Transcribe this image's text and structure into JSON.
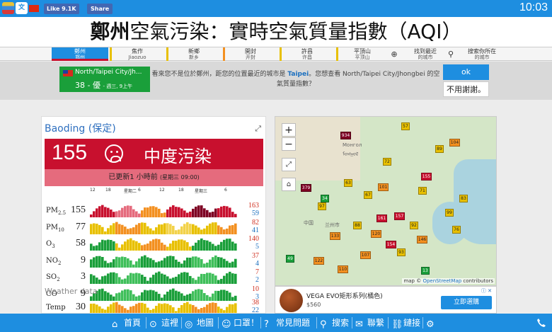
{
  "system_bar": {
    "fb_like_label": "Like 9.1K",
    "share_label": "Share",
    "clock": "10:03"
  },
  "title": {
    "bold": "鄭州",
    "rest": "空氣污染：實時空氣質量指數（AQI）"
  },
  "tabs": [
    {
      "label": "鄭州",
      "sub": "郑州",
      "color": "#c8102e"
    },
    {
      "label": "焦作",
      "sub": "Jiaozuo",
      "color": "#e8c000"
    },
    {
      "label": "新鄉",
      "sub": "新乡",
      "color": "#e8c000"
    },
    {
      "label": "開封",
      "sub": "开封",
      "color": "#f39020"
    },
    {
      "label": "許昌",
      "sub": "许昌",
      "color": "#e8c000"
    },
    {
      "label": "平頂山",
      "sub": "平顶山",
      "color": "#e8c000"
    },
    {
      "label": "找到最近",
      "sub": "的城市",
      "color": ""
    },
    {
      "label": "搜索你所在",
      "sub": "的城市",
      "color": ""
    }
  ],
  "notice": {
    "loc_city": "North/Taipei City/Jh...",
    "loc_aqi": "38 - 優",
    "loc_time": "- 週三, 9上午",
    "msg_prefix": "看來您不是位於鄭州，距您的位置最近的城市是 ",
    "msg_city": "Taipei",
    "msg_suffix": "。您想查看 North/Taipei City/Jhongbei 的空氣質量指數？",
    "ok_label": "ok",
    "no_label": "不用謝謝。"
  },
  "station": {
    "name": "Baoding (保定)",
    "aqi": "155",
    "level": "中度污染",
    "updated": "已更新1 小時前",
    "updated_time": "(星期三 09:00)",
    "axis_labels": [
      "12",
      "18",
      "星期二",
      "6",
      "12",
      "18",
      "星期三",
      "6"
    ],
    "weather_title": "Weather data"
  },
  "pollutants": [
    {
      "name": "PM",
      "sub": "2.5",
      "value": "155",
      "max": "163",
      "min": "59",
      "palette": "red"
    },
    {
      "name": "PM",
      "sub": "10",
      "value": "77",
      "max": "82",
      "min": "41",
      "palette": "yellow"
    },
    {
      "name": "O",
      "sub": "3",
      "value": "58",
      "max": "140",
      "min": "5",
      "palette": "mixed"
    },
    {
      "name": "NO",
      "sub": "2",
      "value": "9",
      "max": "37",
      "min": "4",
      "palette": "green"
    },
    {
      "name": "SO",
      "sub": "2",
      "value": "3",
      "max": "7",
      "min": "2",
      "palette": "green"
    },
    {
      "name": "CO",
      "sub": "",
      "value": "9",
      "max": "10",
      "min": "3",
      "palette": "green"
    },
    {
      "name": "Temp",
      "sub": "",
      "value": "30",
      "max": "38",
      "min": "22",
      "palette": "temp"
    }
  ],
  "map": {
    "zoom_in": "+",
    "zoom_out": "−",
    "attribution_prefix": "map © ",
    "attribution_link": "OpenStreetMap",
    "attribution_suffix": " contributors",
    "places": [
      "Монгол",
      "ᠮᠣᠩᠭᠣᠯ",
      "兰州市",
      "中国"
    ],
    "markers": [
      {
        "v": "57",
        "c": "#e8c000"
      },
      {
        "v": "934",
        "c": "#7e0023"
      },
      {
        "v": "104",
        "c": "#f39020"
      },
      {
        "v": "72",
        "c": "#e8c000"
      },
      {
        "v": "89",
        "c": "#e8c000"
      },
      {
        "v": "155",
        "c": "#c8102e"
      },
      {
        "v": "379",
        "c": "#7e0023"
      },
      {
        "v": "34",
        "c": "#1a9f3a"
      },
      {
        "v": "97",
        "c": "#e8c000"
      },
      {
        "v": "161",
        "c": "#c8102e"
      },
      {
        "v": "157",
        "c": "#c8102e"
      },
      {
        "v": "76",
        "c": "#e8c000"
      },
      {
        "v": "99",
        "c": "#e8c000"
      },
      {
        "v": "133",
        "c": "#f39020"
      },
      {
        "v": "154",
        "c": "#c8102e"
      },
      {
        "v": "122",
        "c": "#f39020"
      },
      {
        "v": "107",
        "c": "#f39020"
      },
      {
        "v": "93",
        "c": "#e8c000"
      },
      {
        "v": "13",
        "c": "#1a9f3a"
      },
      {
        "v": "88",
        "c": "#e8c000"
      },
      {
        "v": "120",
        "c": "#f39020"
      },
      {
        "v": "63",
        "c": "#e8c000"
      },
      {
        "v": "71",
        "c": "#e8c000"
      },
      {
        "v": "92",
        "c": "#e8c000"
      },
      {
        "v": "49",
        "c": "#1a9f3a"
      },
      {
        "v": "110",
        "c": "#f39020"
      },
      {
        "v": "83",
        "c": "#e8c000"
      },
      {
        "v": "146",
        "c": "#f39020"
      },
      {
        "v": "67",
        "c": "#e8c000"
      },
      {
        "v": "101",
        "c": "#f39020"
      }
    ]
  },
  "ad": {
    "title": "VEGA EVO矩形系列(橘色)",
    "price": "$560",
    "button": "立即選購",
    "info": "ⓘ ✕"
  },
  "bottom_nav": [
    {
      "label": "首頁",
      "icon": "home-icon"
    },
    {
      "label": "這裡",
      "icon": "location-icon"
    },
    {
      "label": "地圖",
      "icon": "globe-icon"
    },
    {
      "label": "口罩！",
      "icon": "mask-icon"
    },
    {
      "label": "常見問題",
      "icon": "faq-icon"
    },
    {
      "label": "搜索",
      "icon": "search-icon"
    },
    {
      "label": "聯繫",
      "icon": "contact-icon"
    },
    {
      "label": "鏈接",
      "icon": "link-icon"
    },
    {
      "label": "",
      "icon": "settings-icon"
    }
  ],
  "colors": {
    "accent": "#1e8ee0",
    "unhealthy": "#c8102e",
    "good": "#1a9f3a",
    "moderate": "#e8c000"
  }
}
